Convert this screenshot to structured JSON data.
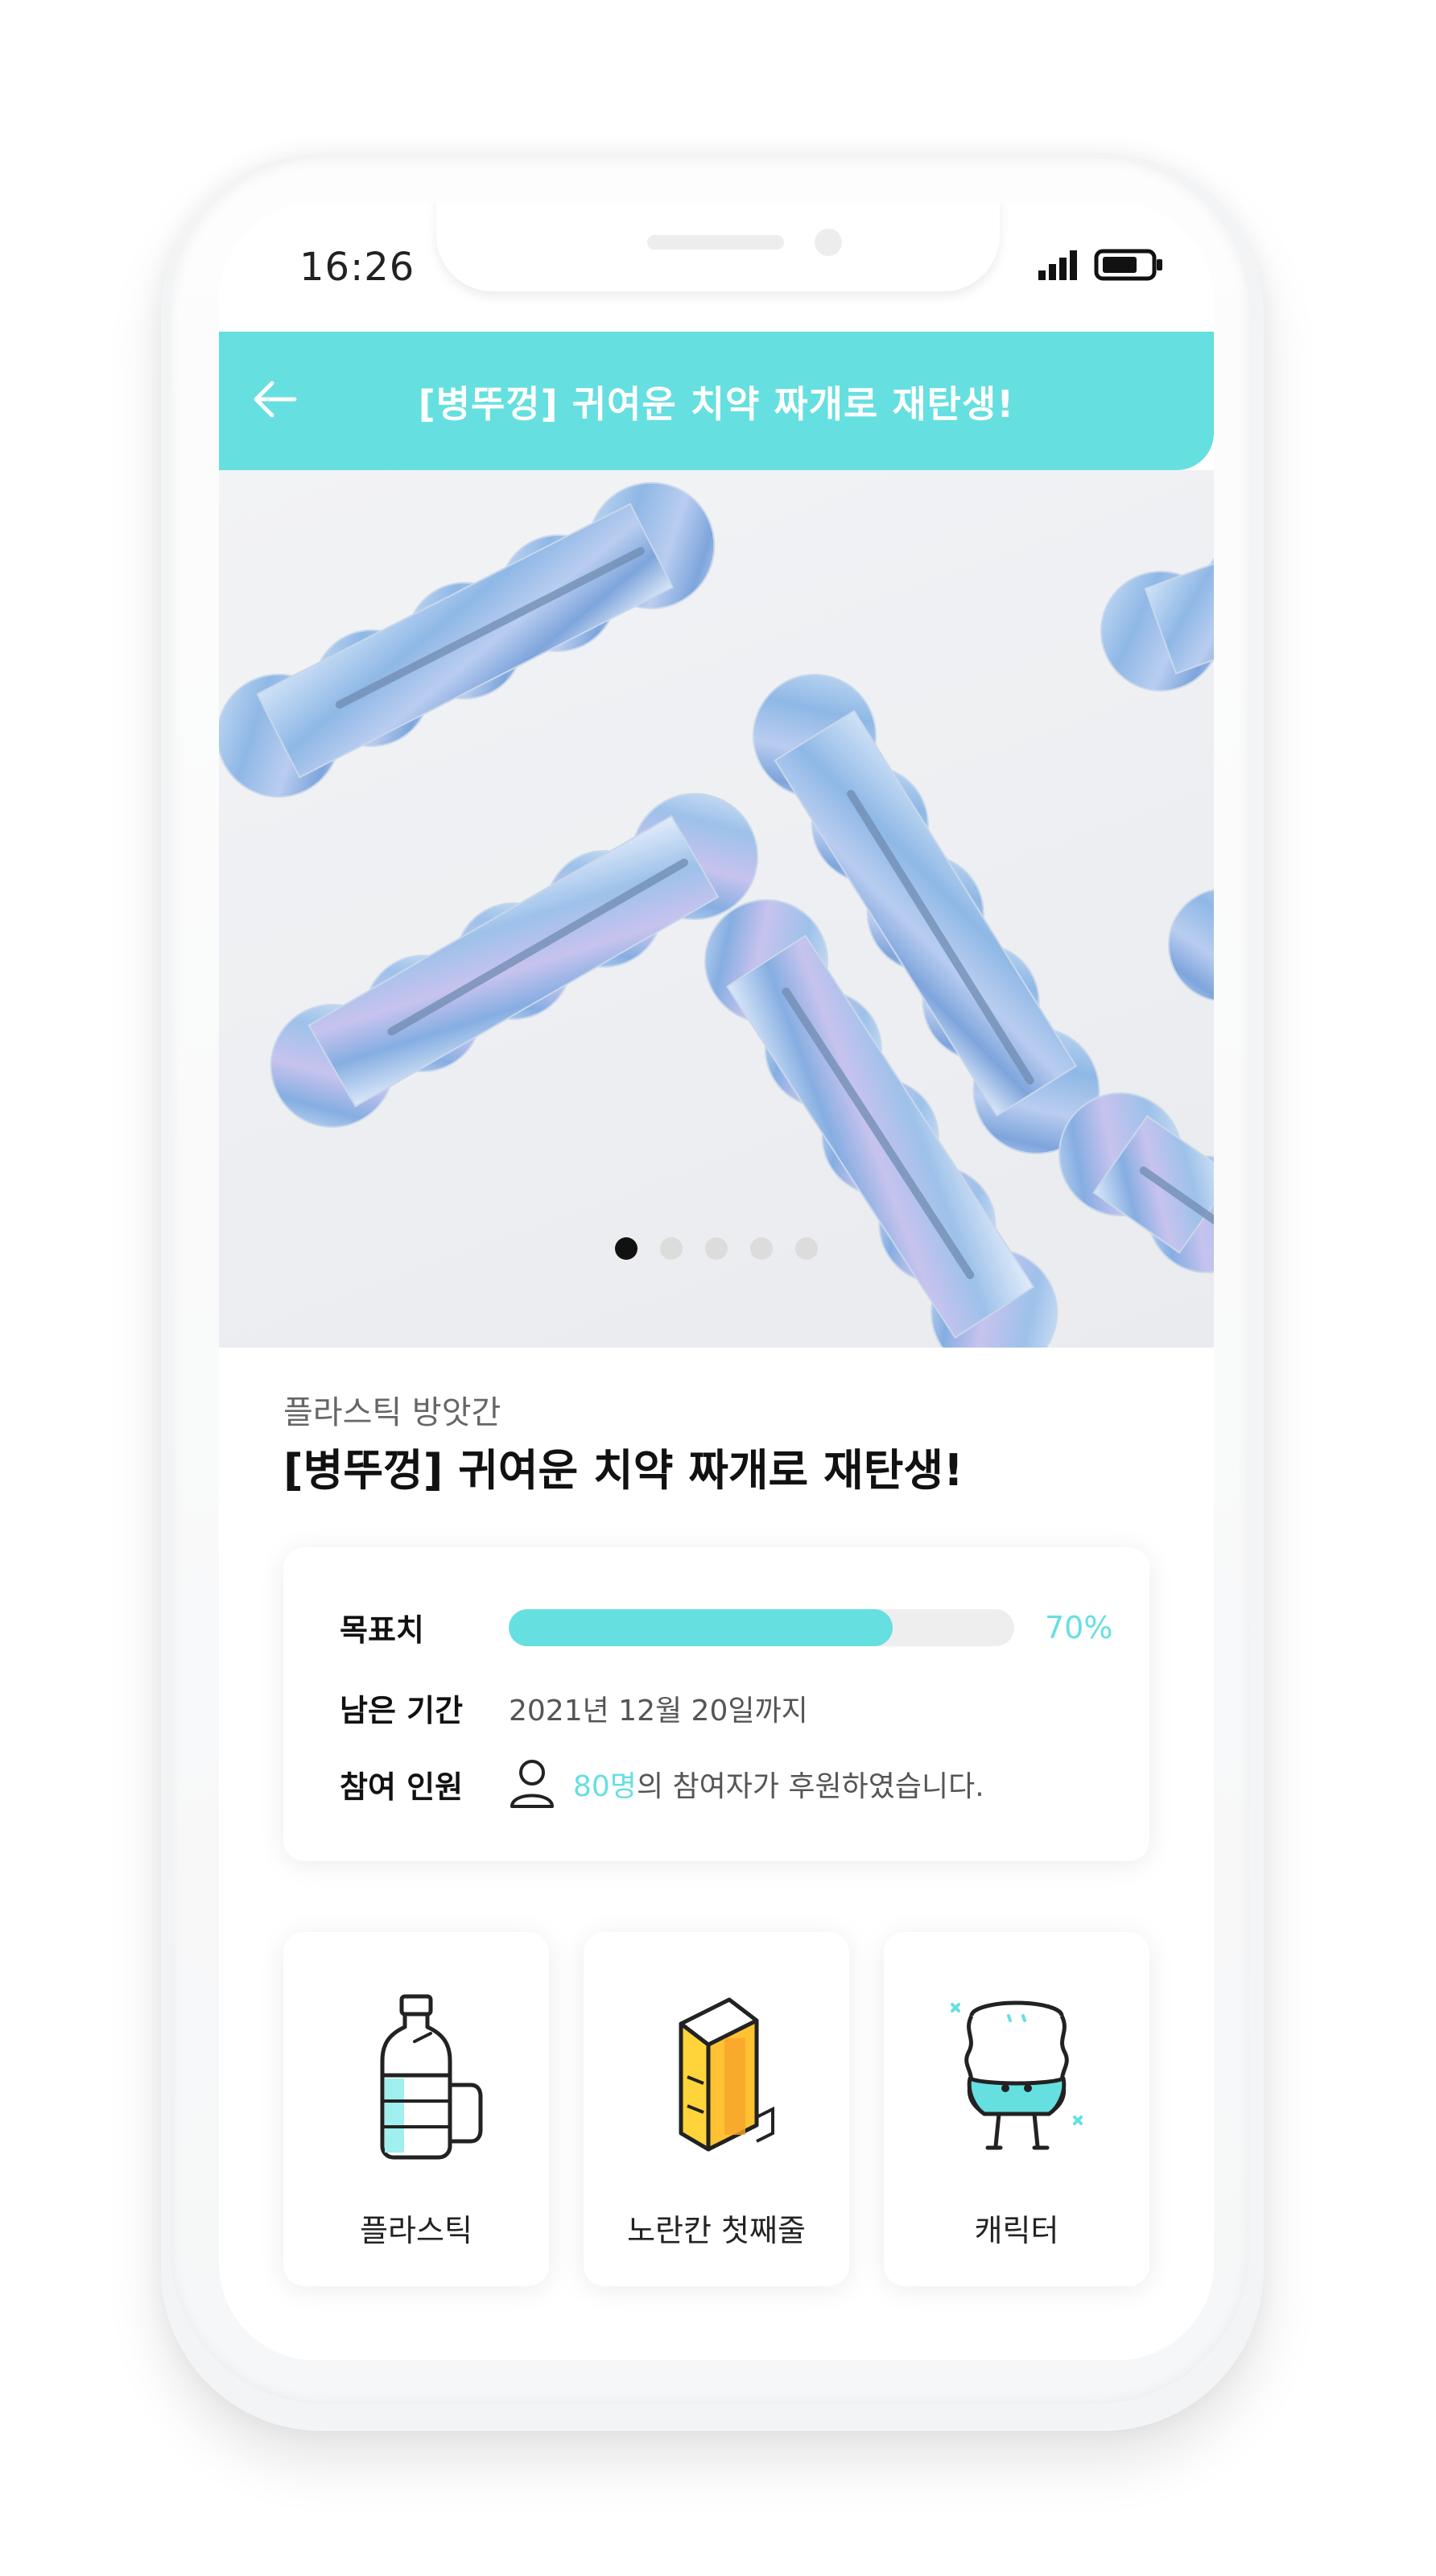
{
  "status_bar": {
    "time": "16:26",
    "signal_icon": "signal-bars-icon",
    "battery_icon": "battery-icon"
  },
  "header": {
    "back_icon": "arrow-left-icon",
    "title": "[병뚜껑] 귀여운 치약 짜개로 재탄생!",
    "background_color": "#66dfe0"
  },
  "hero": {
    "image_description": "marbled blue plastic toothpaste squeezers",
    "carousel": {
      "count": 5,
      "active_index": 0
    }
  },
  "product": {
    "brand": "플라스틱 방앗간",
    "title": "[병뚜껑] 귀여운 치약 짜개로 재탄생!"
  },
  "funding": {
    "goal_label": "목표치",
    "progress_fraction": 0.76,
    "progress_text": "70%",
    "remaining_label": "남은 기간",
    "deadline": "2021년 12월 20일까지",
    "participants_label": "참여 인원",
    "participants_icon": "person-icon",
    "participants_count": "80명",
    "participants_suffix": "의 참여자가 후원하였습니다.",
    "accent_color": "#66dfe0"
  },
  "categories": [
    {
      "label": "플라스틱",
      "icon": "plastic-bottle-icon"
    },
    {
      "label": "노란칸 첫째줄",
      "icon": "yellow-box-icon"
    },
    {
      "label": "캐릭터",
      "icon": "character-icon"
    }
  ]
}
